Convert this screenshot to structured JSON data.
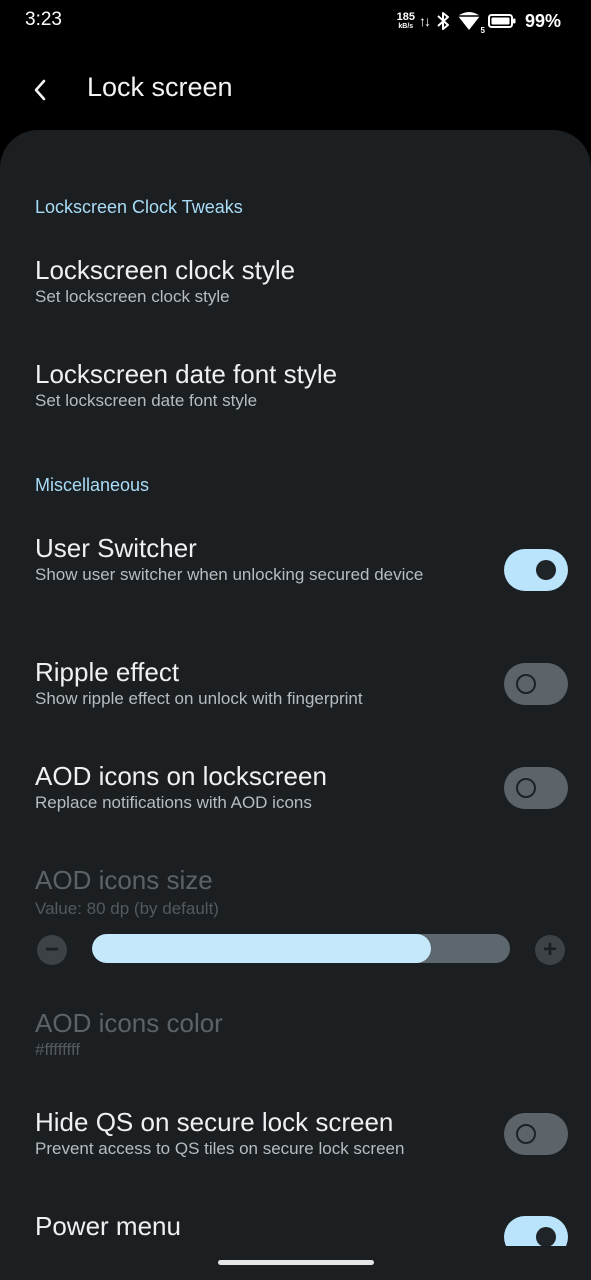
{
  "status_bar": {
    "time": "3:23",
    "net_speed_value": "185",
    "net_speed_unit": "kB/s",
    "net_arrows": "↑↓",
    "wifi_badge": "5",
    "battery_percent": "99%"
  },
  "app_bar": {
    "title": "Lock screen",
    "back_icon": "arrow-back-icon"
  },
  "sections": {
    "clock_tweaks": {
      "header": "Lockscreen Clock Tweaks",
      "clock_style": {
        "title": "Lockscreen clock style",
        "summary": "Set lockscreen clock style"
      },
      "date_font": {
        "title": "Lockscreen date font style",
        "summary": "Set lockscreen date font style"
      }
    },
    "misc": {
      "header": "Miscellaneous",
      "user_switcher": {
        "title": "User Switcher",
        "summary": "Show user switcher when unlocking secured device",
        "checked": true
      },
      "ripple": {
        "title": "Ripple effect",
        "summary": "Show ripple effect on unlock with fingerprint",
        "checked": false
      },
      "aod_icons": {
        "title": "AOD icons on lockscreen",
        "summary": "Replace notifications with AOD icons",
        "checked": false
      },
      "aod_size": {
        "title": "AOD icons size",
        "summary": "Value: 80 dp (by default)",
        "fill_fraction": 0.81,
        "enabled": false,
        "minus_symbol": "−",
        "plus_symbol": "+"
      },
      "aod_color": {
        "title": "AOD icons color",
        "summary": "#ffffffff",
        "enabled": false
      },
      "hide_qs": {
        "title": "Hide QS on secure lock screen",
        "summary": "Prevent access to QS tiles on secure lock screen",
        "checked": false
      },
      "power_menu": {
        "title": "Power menu",
        "checked": true
      }
    }
  },
  "colors": {
    "accent": "#a9dcf7",
    "switch_on": "#b9e4fc",
    "switch_off": "#5c646a",
    "panel": "#1b1f22",
    "background": "#000000"
  }
}
